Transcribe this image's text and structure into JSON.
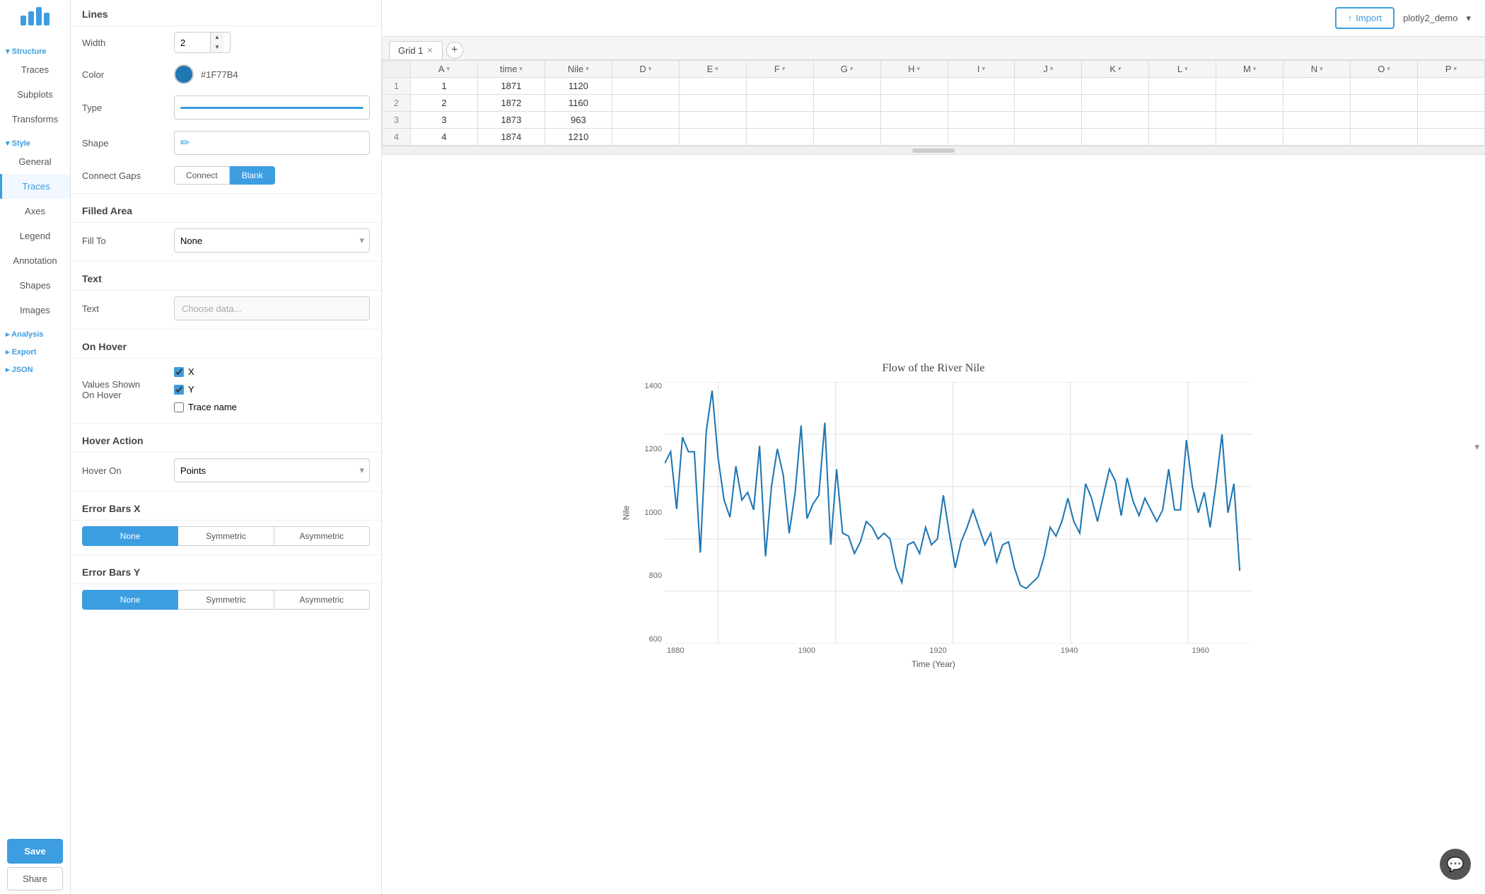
{
  "app": {
    "logo": "plotly-logo",
    "user": "plotly2_demo",
    "import_label": "Import"
  },
  "left_nav": {
    "structure_label": "Structure",
    "items_top": [
      "Traces",
      "Subplots",
      "Transforms"
    ],
    "style_label": "Style",
    "items_style": [
      "General",
      "Traces",
      "Axes",
      "Legend",
      "Annotation",
      "Shapes",
      "Images"
    ],
    "analysis_label": "Analysis",
    "export_label": "Export",
    "json_label": "JSON",
    "save_label": "Save",
    "share_label": "Share"
  },
  "panel": {
    "lines_header": "Lines",
    "width_label": "Width",
    "width_value": "2",
    "color_label": "Color",
    "color_hex": "#1F77B4",
    "type_label": "Type",
    "shape_label": "Shape",
    "connect_gaps_label": "Connect Gaps",
    "connect_label": "Connect",
    "blank_label": "Blank",
    "filled_area_header": "Filled Area",
    "fill_to_label": "Fill To",
    "fill_to_value": "None",
    "text_header": "Text",
    "text_label": "Text",
    "text_placeholder": "Choose data...",
    "on_hover_header": "On Hover",
    "values_shown_label": "Values Shown",
    "on_hover_label": "On Hover",
    "x_label": "X",
    "y_label": "Y",
    "trace_name_label": "Trace name",
    "hover_action_header": "Hover Action",
    "hover_on_label": "Hover On",
    "hover_on_value": "Points",
    "error_bars_x_header": "Error Bars X",
    "error_bars_y_header": "Error Bars Y",
    "none_label": "None",
    "symmetric_label": "Symmetric",
    "asymmetric_label": "Asymmetric",
    "x_checked": true,
    "y_checked": true,
    "trace_name_checked": false
  },
  "grid": {
    "tab_label": "Grid 1",
    "columns": [
      "",
      "A",
      "time",
      "Nile",
      "D",
      "E",
      "F",
      "G",
      "H",
      "I",
      "J",
      "K",
      "L",
      "M",
      "N",
      "O",
      "P"
    ],
    "rows": [
      [
        "1",
        "1",
        "1871",
        "1120"
      ],
      [
        "2",
        "2",
        "1872",
        "1160"
      ],
      [
        "3",
        "3",
        "1873",
        "963"
      ],
      [
        "4",
        "4",
        "1874",
        "1210"
      ]
    ]
  },
  "chart": {
    "title": "Flow of the River Nile",
    "x_label": "Time (Year)",
    "y_label": "Nile",
    "y_min": 500,
    "y_max": 1400,
    "x_min": 1871,
    "x_max": 1970,
    "gridlines_y": [
      600,
      800,
      1000,
      1200,
      1400
    ],
    "gridlines_x": [
      1880,
      1900,
      1920,
      1940,
      1960
    ],
    "data_points": [
      [
        1871,
        1120
      ],
      [
        1872,
        1160
      ],
      [
        1873,
        963
      ],
      [
        1874,
        1210
      ],
      [
        1875,
        1160
      ],
      [
        1876,
        1160
      ],
      [
        1877,
        813
      ],
      [
        1878,
        1230
      ],
      [
        1879,
        1370
      ],
      [
        1880,
        1140
      ],
      [
        1881,
        995
      ],
      [
        1882,
        935
      ],
      [
        1883,
        1110
      ],
      [
        1884,
        994
      ],
      [
        1885,
        1020
      ],
      [
        1886,
        960
      ],
      [
        1887,
        1180
      ],
      [
        1888,
        800
      ],
      [
        1889,
        1040
      ],
      [
        1890,
        1170
      ],
      [
        1891,
        1080
      ],
      [
        1892,
        880
      ],
      [
        1893,
        1020
      ],
      [
        1894,
        1250
      ],
      [
        1895,
        930
      ],
      [
        1896,
        980
      ],
      [
        1897,
        1010
      ],
      [
        1898,
        1260
      ],
      [
        1899,
        840
      ],
      [
        1900,
        1100
      ],
      [
        1901,
        880
      ],
      [
        1902,
        870
      ],
      [
        1903,
        810
      ],
      [
        1904,
        850
      ],
      [
        1905,
        920
      ],
      [
        1906,
        900
      ],
      [
        1907,
        860
      ],
      [
        1908,
        880
      ],
      [
        1909,
        860
      ],
      [
        1910,
        760
      ],
      [
        1911,
        710
      ],
      [
        1912,
        840
      ],
      [
        1913,
        850
      ],
      [
        1914,
        810
      ],
      [
        1915,
        900
      ],
      [
        1916,
        840
      ],
      [
        1917,
        860
      ],
      [
        1918,
        1010
      ],
      [
        1919,
        880
      ],
      [
        1920,
        760
      ],
      [
        1921,
        850
      ],
      [
        1922,
        900
      ],
      [
        1923,
        960
      ],
      [
        1924,
        900
      ],
      [
        1925,
        840
      ],
      [
        1926,
        880
      ],
      [
        1927,
        780
      ],
      [
        1928,
        840
      ],
      [
        1929,
        850
      ],
      [
        1930,
        760
      ],
      [
        1931,
        700
      ],
      [
        1932,
        690
      ],
      [
        1933,
        710
      ],
      [
        1934,
        730
      ],
      [
        1935,
        800
      ],
      [
        1936,
        900
      ],
      [
        1937,
        870
      ],
      [
        1938,
        920
      ],
      [
        1939,
        1000
      ],
      [
        1940,
        920
      ],
      [
        1941,
        880
      ],
      [
        1942,
        1050
      ],
      [
        1943,
        1000
      ],
      [
        1944,
        920
      ],
      [
        1945,
        1010
      ],
      [
        1946,
        1100
      ],
      [
        1947,
        1060
      ],
      [
        1948,
        940
      ],
      [
        1949,
        1070
      ],
      [
        1950,
        990
      ],
      [
        1951,
        940
      ],
      [
        1952,
        1000
      ],
      [
        1953,
        960
      ],
      [
        1954,
        920
      ],
      [
        1955,
        960
      ],
      [
        1956,
        1100
      ],
      [
        1957,
        960
      ],
      [
        1958,
        960
      ],
      [
        1959,
        1200
      ],
      [
        1960,
        1040
      ],
      [
        1961,
        950
      ],
      [
        1962,
        1020
      ],
      [
        1963,
        900
      ],
      [
        1964,
        1050
      ],
      [
        1965,
        1220
      ],
      [
        1966,
        950
      ],
      [
        1967,
        1050
      ],
      [
        1968,
        750
      ]
    ]
  }
}
